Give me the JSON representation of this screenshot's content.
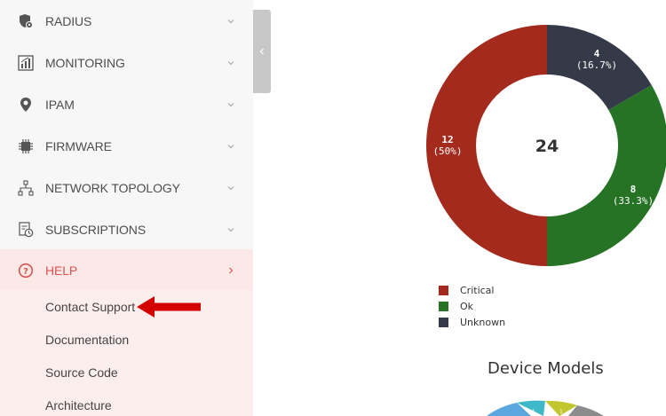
{
  "sidebar": {
    "items": [
      {
        "label": "RADIUS",
        "icon": "shield-gear-icon"
      },
      {
        "label": "MONITORING",
        "icon": "chart-icon"
      },
      {
        "label": "IPAM",
        "icon": "location-pin-icon"
      },
      {
        "label": "FIRMWARE",
        "icon": "chip-icon"
      },
      {
        "label": "NETWORK TOPOLOGY",
        "icon": "topology-icon"
      },
      {
        "label": "SUBSCRIPTIONS",
        "icon": "subscription-icon"
      },
      {
        "label": "HELP",
        "icon": "help-circle-icon",
        "active": true
      }
    ],
    "help_submenu": [
      {
        "label": "Contact Support"
      },
      {
        "label": "Documentation"
      },
      {
        "label": "Source Code"
      },
      {
        "label": "Architecture"
      }
    ]
  },
  "colors": {
    "accent": "#d9534f",
    "critical": "#a52a1e",
    "ok": "#267326",
    "unknown": "#343a48",
    "annotation_arrow": "#d40000"
  },
  "chart_data": [
    {
      "type": "pie",
      "title": "",
      "donut": true,
      "center_label": "24",
      "slices": [
        {
          "name": "Critical",
          "value": 12,
          "percent": "50%"
        },
        {
          "name": "Ok",
          "value": 8,
          "percent": "33.3%"
        },
        {
          "name": "Unknown",
          "value": 4,
          "percent": "16.7%"
        }
      ],
      "legend_position": "bottom-left"
    },
    {
      "type": "pie",
      "title": "Device Models"
    }
  ]
}
